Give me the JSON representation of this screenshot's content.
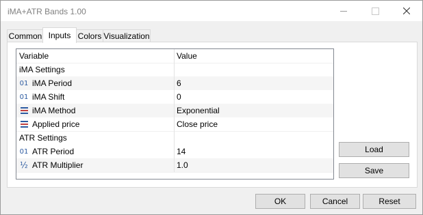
{
  "window": {
    "title": "iMA+ATR Bands 1.00"
  },
  "tabs": [
    "Common",
    "Inputs",
    "Colors",
    "Visualization"
  ],
  "active_tab": "Inputs",
  "grid": {
    "headers": {
      "variable": "Variable",
      "value": "Value"
    },
    "groups": [
      {
        "label": "iMA Settings"
      },
      {
        "label": "ATR Settings"
      }
    ],
    "params": [
      {
        "icon": "integer-icon",
        "name": "iMA Period",
        "value": "6"
      },
      {
        "icon": "integer-icon",
        "name": "iMA Shift",
        "value": "0"
      },
      {
        "icon": "enum-icon",
        "name": "iMA Method",
        "value": "Exponential"
      },
      {
        "icon": "enum-icon",
        "name": "Applied price",
        "value": "Close price"
      },
      {
        "icon": "integer-icon",
        "name": "ATR Period",
        "value": "14"
      },
      {
        "icon": "double-icon",
        "name": "ATR Multiplier",
        "value": "1.0"
      }
    ]
  },
  "icon_glyphs": {
    "integer": "01",
    "double": "½"
  },
  "buttons": {
    "load": "Load",
    "save": "Save",
    "ok": "OK",
    "cancel": "Cancel",
    "reset": "Reset"
  }
}
